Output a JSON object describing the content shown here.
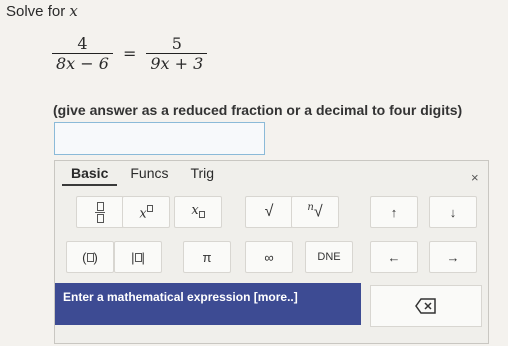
{
  "question": {
    "prompt_prefix": "Solve for",
    "variable": "x",
    "eq_left_num": "4",
    "eq_left_den": "8x − 6",
    "equals": "=",
    "eq_right_num": "5",
    "eq_right_den": "9x + 3",
    "instruction": "(give answer as a reduced fraction or a decimal to four digits)"
  },
  "answer_input": {
    "value": ""
  },
  "keypad": {
    "tabs": [
      "Basic",
      "Funcs",
      "Trig"
    ],
    "active_tab": "Basic",
    "close_label": "×",
    "keys_row1": [
      "fraction",
      "power",
      "subscript",
      "sqrt",
      "nth-root",
      "up-arrow",
      "down-arrow"
    ],
    "keys_row2": [
      "parentheses",
      "abs",
      "π",
      "∞",
      "DNE",
      "left-arrow",
      "right-arrow"
    ],
    "pi_label": "π",
    "infinity_label": "∞",
    "dne_label": "DNE",
    "up_label": "↑",
    "down_label": "↓",
    "left_label": "←",
    "right_label": "→",
    "sqrt_label": "√",
    "x_label": "x",
    "n_label": "n",
    "expression_prompt": "Enter a mathematical expression [more..]"
  },
  "colors": {
    "accent": "#3d4b93",
    "input_border": "#8bbad8"
  }
}
